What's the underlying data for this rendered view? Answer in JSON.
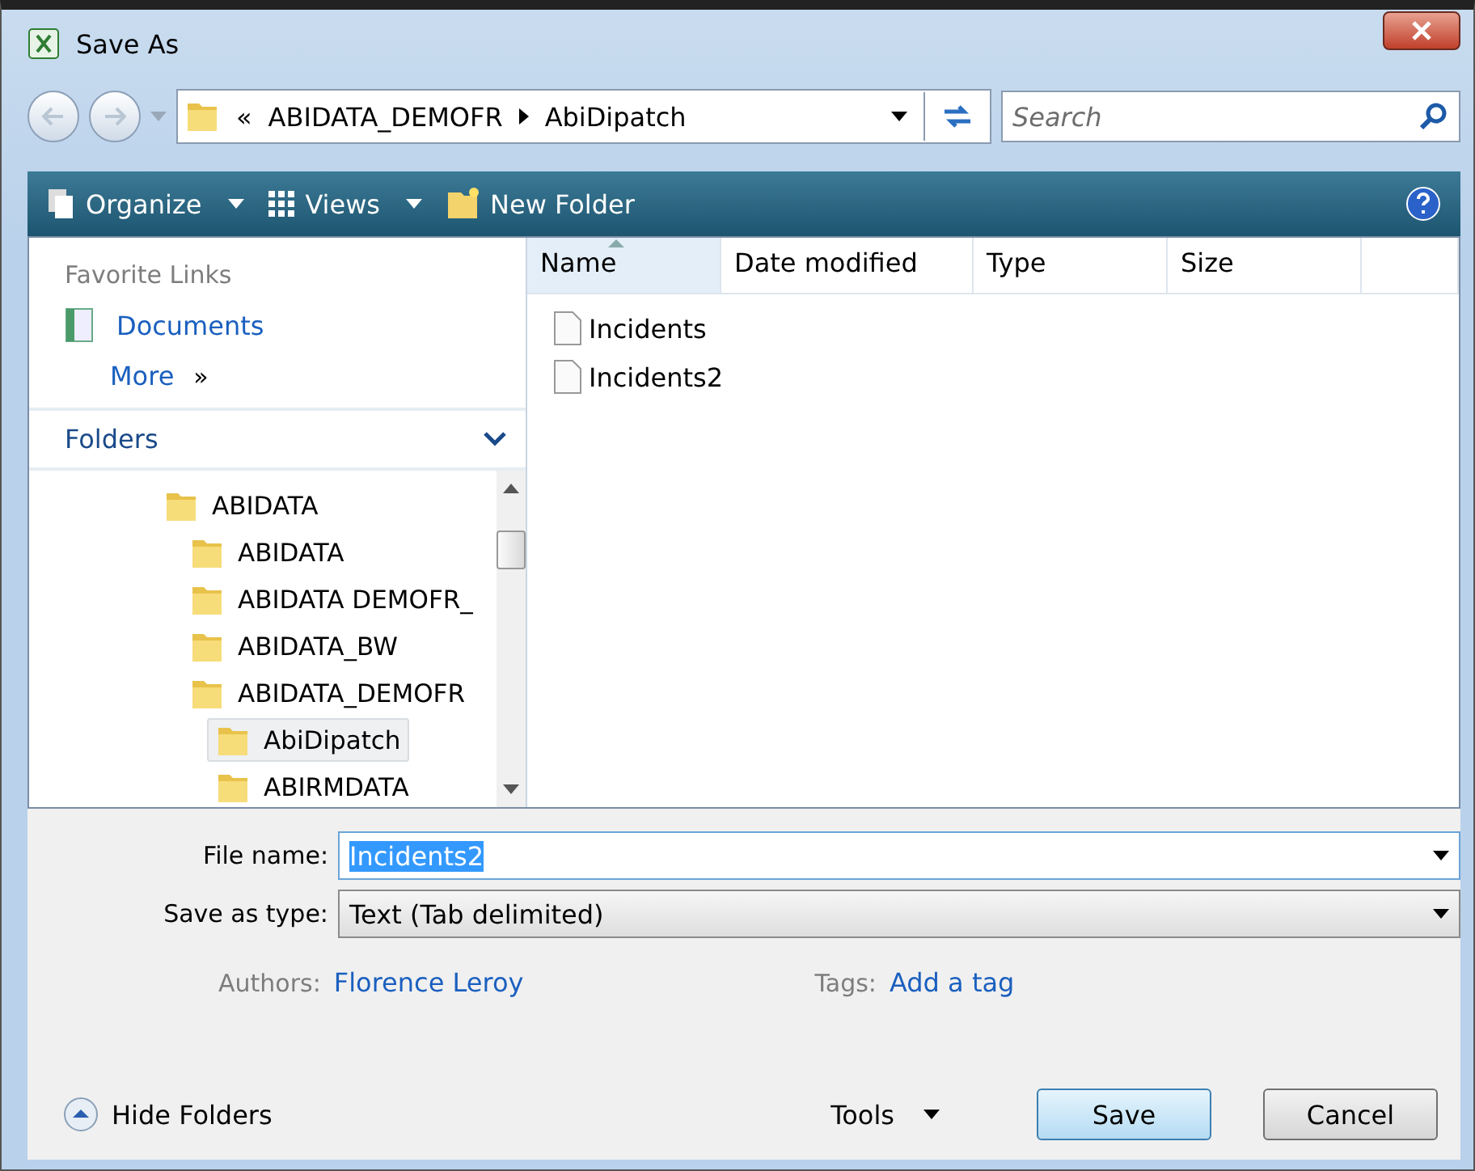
{
  "window": {
    "title": "Save As"
  },
  "address": {
    "path": [
      "ABIDATA_DEMOFR",
      "AbiDipatch"
    ],
    "overflow": "«"
  },
  "search": {
    "placeholder": "Search"
  },
  "toolbar": [
    {
      "label": "Organize",
      "kind": "organize"
    },
    {
      "label": "Views",
      "kind": "views"
    },
    {
      "label": "New Folder",
      "kind": "newfolder"
    }
  ],
  "favorites": {
    "title": "Favorite Links",
    "items": [
      {
        "label": "Documents"
      }
    ],
    "more": "More",
    "more_glyph": "»"
  },
  "folders": {
    "title": "Folders",
    "tree": [
      {
        "label": "ABIDATA",
        "selected": false,
        "children": [
          {
            "label": "ABIDATA",
            "selected": false
          },
          {
            "label": "ABIDATA DEMOFR_",
            "selected": false
          },
          {
            "label": "ABIDATA_BW",
            "selected": false
          },
          {
            "label": "ABIDATA_DEMOFR",
            "selected": false,
            "children": [
              {
                "label": "AbiDipatch",
                "selected": true
              },
              {
                "label": "ABIRMDATA",
                "selected": false
              }
            ]
          }
        ]
      }
    ]
  },
  "table": {
    "columns": [
      {
        "label": "Name",
        "sorted": true
      },
      {
        "label": "Date modified",
        "sorted": false
      },
      {
        "label": "Type",
        "sorted": false
      },
      {
        "label": "Size",
        "sorted": false
      }
    ],
    "rows": [
      {
        "name": "Incidents"
      },
      {
        "name": "Incidents2"
      }
    ]
  },
  "form": {
    "file_name_label": "File name:",
    "file_name": "Incidents2",
    "type_label": "Save as type:",
    "type": "Text (Tab delimited)",
    "authors_label": "Authors:",
    "authors": "Florence Leroy",
    "tags_label": "Tags:",
    "tags": "Add a tag"
  },
  "hide_folders": "Hide Folders",
  "tools": "Tools",
  "buttons": [
    {
      "label": "Save",
      "default": true
    },
    {
      "label": "Cancel",
      "default": false
    }
  ]
}
